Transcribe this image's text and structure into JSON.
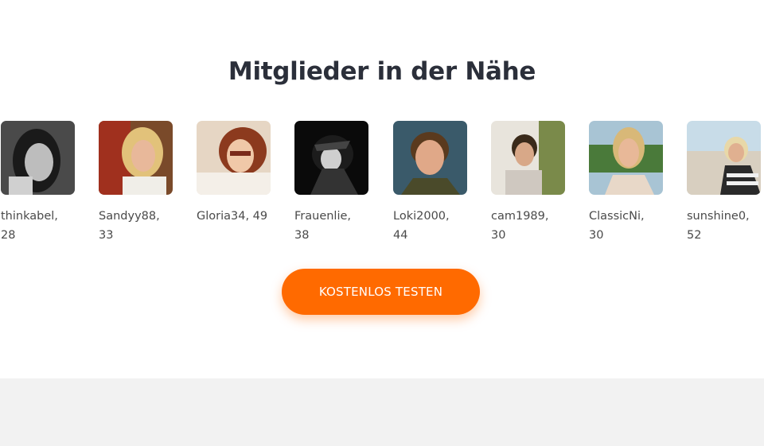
{
  "section": {
    "title": "Mitglieder in der Nähe"
  },
  "members": [
    {
      "name": "thinkabel,",
      "age": "28"
    },
    {
      "name": "Sandyy88,",
      "age": "33"
    },
    {
      "name": "Gloria34, 49",
      "age": ""
    },
    {
      "name": "Frauenlie,",
      "age": "38"
    },
    {
      "name": "Loki2000,",
      "age": "44"
    },
    {
      "name": "cam1989,",
      "age": "30"
    },
    {
      "name": "ClassicNi,",
      "age": "30"
    },
    {
      "name": "sunshine0,",
      "age": "52"
    }
  ],
  "cta": {
    "label": "KOSTENLOS TESTEN"
  },
  "colors": {
    "accent": "#ff6a00",
    "title": "#2b2f3a",
    "footer": "#f2f2f2"
  }
}
